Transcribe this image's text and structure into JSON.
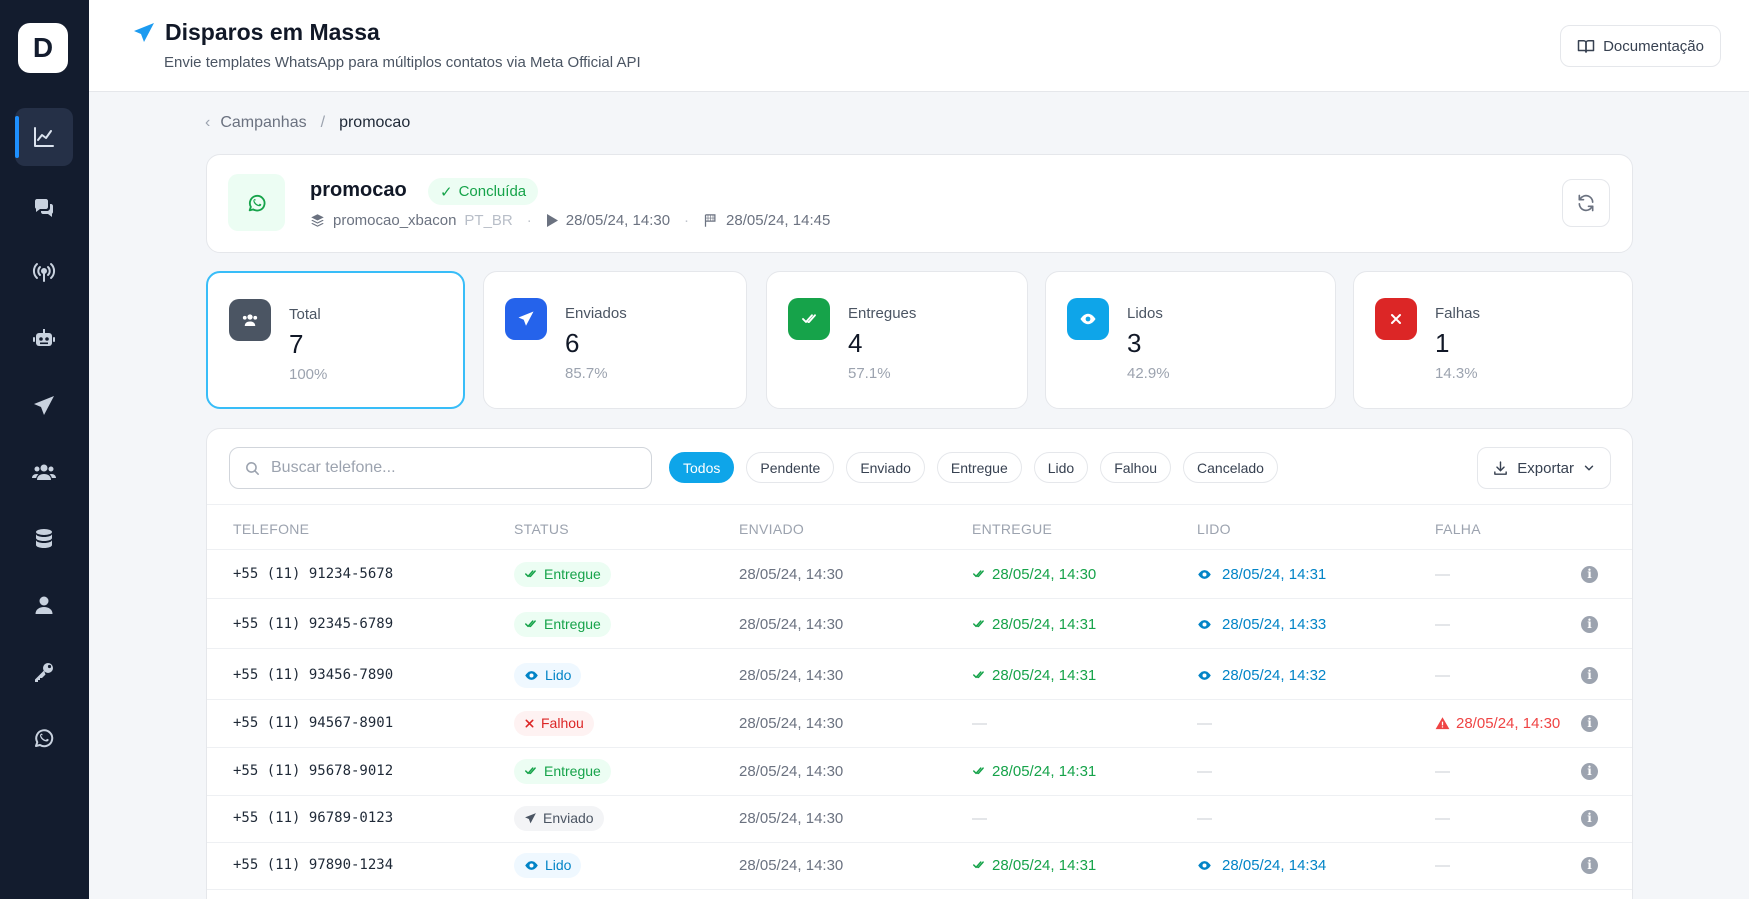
{
  "app": {
    "logo_letter": "D"
  },
  "header": {
    "title": "Disparos em Massa",
    "subtitle": "Envie templates WhatsApp para múltiplos contatos via Meta Official API",
    "doc_button": "Documentação"
  },
  "breadcrumb": {
    "parent": "Campanhas",
    "separator": "/",
    "current": "promocao"
  },
  "campaign": {
    "name": "promocao",
    "status": "Concluída",
    "template": "promocao_xbacon",
    "language": "PT_BR",
    "started": "28/05/24, 14:30",
    "finished": "28/05/24, 14:45"
  },
  "stats": [
    {
      "label": "Total",
      "value": "7",
      "pct": "100%",
      "color": "#4b5563"
    },
    {
      "label": "Enviados",
      "value": "6",
      "pct": "85.7%",
      "color": "#2563eb"
    },
    {
      "label": "Entregues",
      "value": "4",
      "pct": "57.1%",
      "color": "#16a34a"
    },
    {
      "label": "Lidos",
      "value": "3",
      "pct": "42.9%",
      "color": "#0ea5e9"
    },
    {
      "label": "Falhas",
      "value": "1",
      "pct": "14.3%",
      "color": "#dc2626"
    }
  ],
  "filters": {
    "search_placeholder": "Buscar telefone...",
    "chips": [
      "Todos",
      "Pendente",
      "Enviado",
      "Entregue",
      "Lido",
      "Falhou",
      "Cancelado"
    ],
    "active_chip": "Todos",
    "export_label": "Exportar"
  },
  "table": {
    "columns": [
      "TELEFONE",
      "STATUS",
      "ENVIADO",
      "ENTREGUE",
      "LIDO",
      "FALHA"
    ],
    "rows": [
      {
        "phone": "+55 (11) 91234-5678",
        "status": "Entregue",
        "sent": "28/05/24, 14:30",
        "delivered": "28/05/24, 14:30",
        "read": "28/05/24, 14:31",
        "failed": "—"
      },
      {
        "phone": "+55 (11) 92345-6789",
        "status": "Entregue",
        "sent": "28/05/24, 14:30",
        "delivered": "28/05/24, 14:31",
        "read": "28/05/24, 14:33",
        "failed": "—"
      },
      {
        "phone": "+55 (11) 93456-7890",
        "status": "Lido",
        "sent": "28/05/24, 14:30",
        "delivered": "28/05/24, 14:31",
        "read": "28/05/24, 14:32",
        "failed": "—"
      },
      {
        "phone": "+55 (11) 94567-8901",
        "status": "Falhou",
        "sent": "28/05/24, 14:30",
        "delivered": "—",
        "read": "—",
        "failed": "28/05/24, 14:30"
      },
      {
        "phone": "+55 (11) 95678-9012",
        "status": "Entregue",
        "sent": "28/05/24, 14:30",
        "delivered": "28/05/24, 14:31",
        "read": "—",
        "failed": "—"
      },
      {
        "phone": "+55 (11) 96789-0123",
        "status": "Enviado",
        "sent": "28/05/24, 14:30",
        "delivered": "—",
        "read": "—",
        "failed": "—"
      },
      {
        "phone": "+55 (11) 97890-1234",
        "status": "Lido",
        "sent": "28/05/24, 14:30",
        "delivered": "28/05/24, 14:31",
        "read": "28/05/24, 14:34",
        "failed": "—"
      }
    ]
  }
}
